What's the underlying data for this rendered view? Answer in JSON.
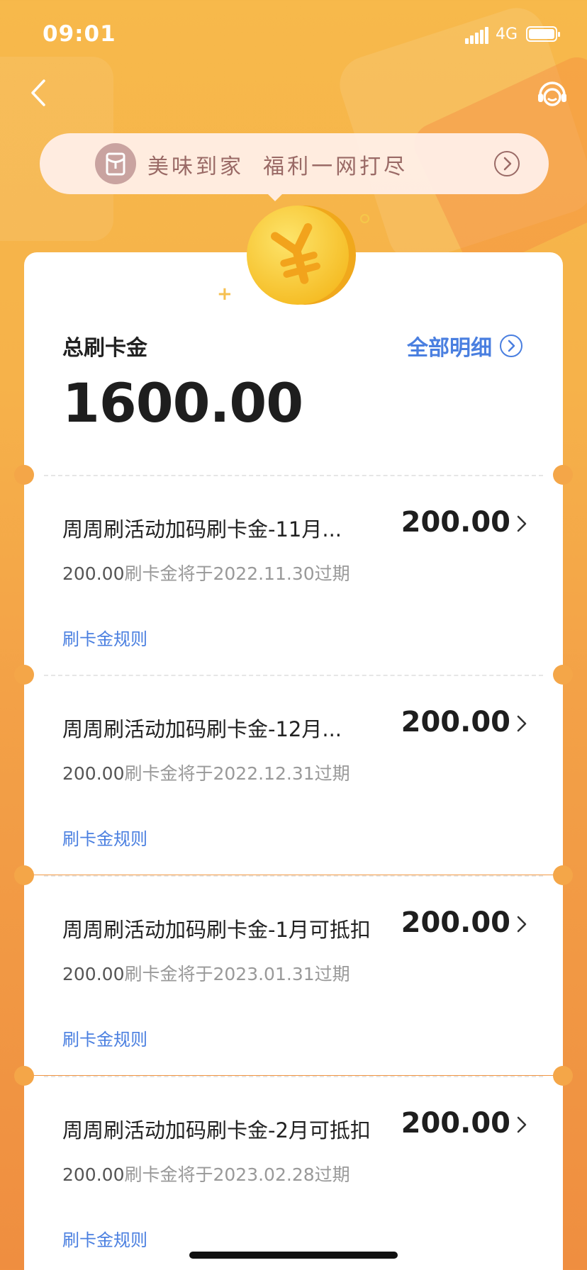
{
  "status_bar": {
    "time": "09:01",
    "network": "4G"
  },
  "nav": {
    "back_icon": "chevron-left-icon",
    "service_icon": "customer-service-icon"
  },
  "banner": {
    "text": "美味到家  福利一网打尽",
    "icon": "red-envelope-icon",
    "arrow_icon": "chevron-right-circle-icon"
  },
  "summary": {
    "label": "总刷卡金",
    "amount": "1600.00",
    "detail_link": "全部明细"
  },
  "items": [
    {
      "title": "周周刷活动加码刷卡金-11月...",
      "amount": "200.00",
      "sub_amount": "200.00",
      "sub_text": "刷卡金将于2022.11.30过期",
      "rule": "刷卡金规则"
    },
    {
      "title": "周周刷活动加码刷卡金-12月...",
      "amount": "200.00",
      "sub_amount": "200.00",
      "sub_text": "刷卡金将于2022.12.31过期",
      "rule": "刷卡金规则"
    },
    {
      "title": "周周刷活动加码刷卡金-1月可抵扣",
      "amount": "200.00",
      "sub_amount": "200.00",
      "sub_text": "刷卡金将于2023.01.31过期",
      "rule": "刷卡金规则"
    },
    {
      "title": "周周刷活动加码刷卡金-2月可抵扣",
      "amount": "200.00",
      "sub_amount": "200.00",
      "sub_text": "刷卡金将于2023.02.28过期",
      "rule": "刷卡金规则"
    }
  ],
  "colors": {
    "accent_blue": "#4a7fe0",
    "background_orange": "#f4a648",
    "coin_yellow": "#f7c62e"
  }
}
